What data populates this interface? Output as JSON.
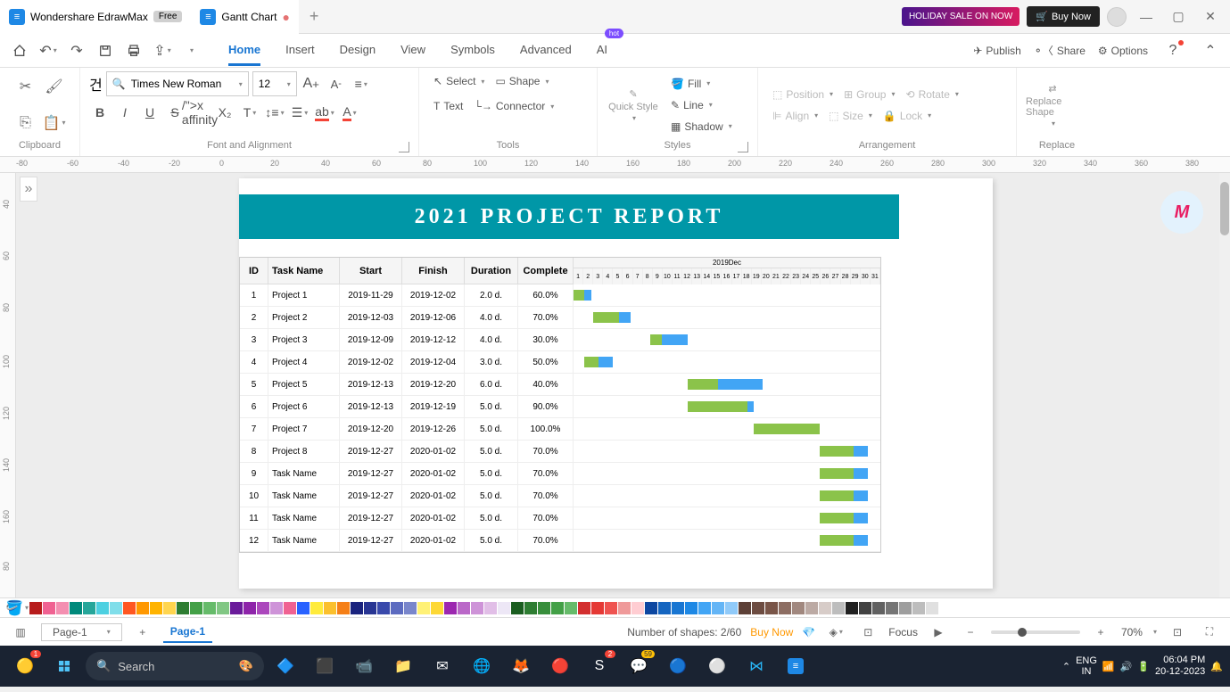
{
  "titlebar": {
    "app_name": "Wondershare EdrawMax",
    "free_label": "Free",
    "active_tab": "Gantt Chart",
    "holiday": "HOLIDAY SALE ON NOW",
    "buy_now": "Buy Now"
  },
  "menubar": {
    "tabs": [
      "Home",
      "Insert",
      "Design",
      "View",
      "Symbols",
      "Advanced",
      "AI"
    ],
    "active_tab": "Home",
    "hot_label": "hot",
    "right": {
      "publish": "Publish",
      "share": "Share",
      "options": "Options"
    }
  },
  "ribbon": {
    "font": "Times New Roman",
    "size": "12",
    "groups": {
      "clipboard": "Clipboard",
      "font": "Font and Alignment",
      "tools": "Tools",
      "styles": "Styles",
      "arrangement": "Arrangement",
      "replace": "Replace"
    },
    "tools": {
      "select": "Select",
      "shape": "Shape",
      "text": "Text",
      "connector": "Connector"
    },
    "quick_style": "Quick Style",
    "styles_items": {
      "fill": "Fill",
      "line": "Line",
      "shadow": "Shadow"
    },
    "arr_items": {
      "position": "Position",
      "group": "Group",
      "rotate": "Rotate",
      "align": "Align",
      "size": "Size",
      "lock": "Lock"
    },
    "replace": "Replace Shape"
  },
  "ruler_h": [
    "-80",
    "-60",
    "-40",
    "-20",
    "0",
    "20",
    "40",
    "60",
    "80",
    "100",
    "120",
    "140",
    "160",
    "180",
    "200",
    "220",
    "240",
    "260",
    "280",
    "300",
    "320",
    "340",
    "360",
    "380"
  ],
  "ruler_v": [
    "40",
    "60",
    "80",
    "100",
    "120",
    "140",
    "160",
    "80"
  ],
  "chart_data": {
    "type": "gantt",
    "title": "2021  PROJECT  REPORT",
    "month_label": "2019Dec",
    "days": [
      1,
      2,
      3,
      4,
      5,
      6,
      7,
      8,
      9,
      10,
      11,
      12,
      13,
      14,
      15,
      16,
      17,
      18,
      19,
      20,
      21,
      22,
      23,
      24,
      25,
      26,
      27,
      28,
      29,
      30,
      31
    ],
    "columns": [
      "ID",
      "Task Name",
      "Start",
      "Finish",
      "Duration",
      "Complete"
    ],
    "rows": [
      {
        "id": "1",
        "name": "Project 1",
        "start": "2019-11-29",
        "finish": "2019-12-02",
        "dur": "2.0 d.",
        "comp": "60.0%",
        "bar_start": 0,
        "bar_len": 20,
        "done": 0.6
      },
      {
        "id": "2",
        "name": "Project 2",
        "start": "2019-12-03",
        "finish": "2019-12-06",
        "dur": "4.0 d.",
        "comp": "70.0%",
        "bar_start": 22,
        "bar_len": 42,
        "done": 0.7
      },
      {
        "id": "3",
        "name": "Project 3",
        "start": "2019-12-09",
        "finish": "2019-12-12",
        "dur": "4.0 d.",
        "comp": "30.0%",
        "bar_start": 86,
        "bar_len": 42,
        "done": 0.3
      },
      {
        "id": "4",
        "name": "Project 4",
        "start": "2019-12-02",
        "finish": "2019-12-04",
        "dur": "3.0 d.",
        "comp": "50.0%",
        "bar_start": 12,
        "bar_len": 32,
        "done": 0.5
      },
      {
        "id": "5",
        "name": "Project 5",
        "start": "2019-12-13",
        "finish": "2019-12-20",
        "dur": "6.0 d.",
        "comp": "40.0%",
        "bar_start": 128,
        "bar_len": 84,
        "done": 0.4
      },
      {
        "id": "6",
        "name": "Project 6",
        "start": "2019-12-13",
        "finish": "2019-12-19",
        "dur": "5.0 d.",
        "comp": "90.0%",
        "bar_start": 128,
        "bar_len": 74,
        "done": 0.9
      },
      {
        "id": "7",
        "name": "Project 7",
        "start": "2019-12-20",
        "finish": "2019-12-26",
        "dur": "5.0 d.",
        "comp": "100.0%",
        "bar_start": 202,
        "bar_len": 74,
        "done": 1.0
      },
      {
        "id": "8",
        "name": "Project 8",
        "start": "2019-12-27",
        "finish": "2020-01-02",
        "dur": "5.0 d.",
        "comp": "70.0%",
        "bar_start": 276,
        "bar_len": 54,
        "done": 0.7
      },
      {
        "id": "9",
        "name": "Task Name",
        "start": "2019-12-27",
        "finish": "2020-01-02",
        "dur": "5.0 d.",
        "comp": "70.0%",
        "bar_start": 276,
        "bar_len": 54,
        "done": 0.7
      },
      {
        "id": "10",
        "name": "Task Name",
        "start": "2019-12-27",
        "finish": "2020-01-02",
        "dur": "5.0 d.",
        "comp": "70.0%",
        "bar_start": 276,
        "bar_len": 54,
        "done": 0.7
      },
      {
        "id": "11",
        "name": "Task Name",
        "start": "2019-12-27",
        "finish": "2020-01-02",
        "dur": "5.0 d.",
        "comp": "70.0%",
        "bar_start": 276,
        "bar_len": 54,
        "done": 0.7
      },
      {
        "id": "12",
        "name": "Task Name",
        "start": "2019-12-27",
        "finish": "2020-01-02",
        "dur": "5.0 d.",
        "comp": "70.0%",
        "bar_start": 276,
        "bar_len": 54,
        "done": 0.7
      }
    ]
  },
  "palette": [
    "#b71c1c",
    "#f06292",
    "#f48fb1",
    "#00897b",
    "#26a69a",
    "#4dd0e1",
    "#80deea",
    "#ff5722",
    "#ff9800",
    "#ffb300",
    "#ffd54f",
    "#2e7d32",
    "#43a047",
    "#66bb6a",
    "#81c784",
    "#6a1b9a",
    "#8e24aa",
    "#ab47bc",
    "#ce93d8",
    "#f06292",
    "#2962ff",
    "#ffeb3b",
    "#fbc02d",
    "#f57f17",
    "#1a237e",
    "#283593",
    "#3949ab",
    "#5c6bc0",
    "#7986cb",
    "#fff176",
    "#fdd835",
    "#9c27b0",
    "#ba68c8",
    "#ce93d8",
    "#e1bee7",
    "#ede7f6",
    "#1b5e20",
    "#2e7d32",
    "#388e3c",
    "#43a047",
    "#66bb6a",
    "#d32f2f",
    "#e53935",
    "#ef5350",
    "#ef9a9a",
    "#ffcdd2",
    "#0d47a1",
    "#1565c0",
    "#1976d2",
    "#1e88e5",
    "#42a5f5",
    "#64b5f6",
    "#90caf9",
    "#5d4037",
    "#6d4c41",
    "#795548",
    "#8d6e63",
    "#a1887f",
    "#bcaaa4",
    "#d7ccc8",
    "#bdbdbd",
    "#212121",
    "#424242",
    "#616161",
    "#757575",
    "#9e9e9e",
    "#bdbdbd",
    "#e0e0e0",
    "#ffffff"
  ],
  "statusbar": {
    "page_sel": "Page-1",
    "page_tab": "Page-1",
    "shapes": "Number of shapes: 2/60",
    "buy_now": "Buy Now",
    "focus": "Focus",
    "zoom": "70%"
  },
  "taskbar": {
    "search_placeholder": "Search",
    "lang1": "ENG",
    "lang2": "IN",
    "time": "06:04 PM",
    "date": "20-12-2023"
  }
}
